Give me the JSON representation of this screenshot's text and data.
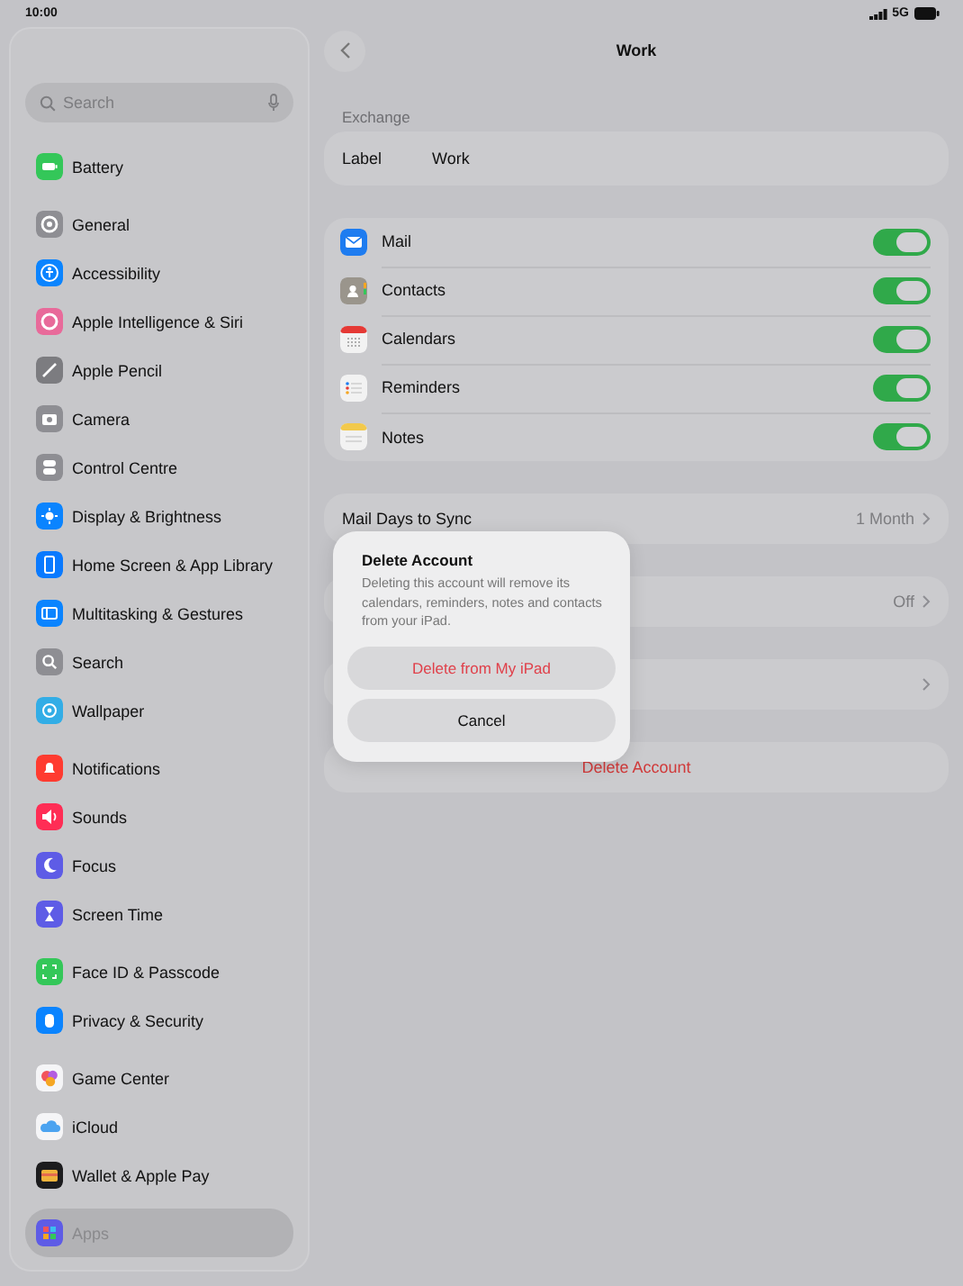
{
  "status_bar": {
    "time": "10:00",
    "network": "5G"
  },
  "sidebar": {
    "search": {
      "placeholder": "Search"
    },
    "groups": [
      [
        {
          "label": "Battery",
          "color": "#34c759",
          "selected": false
        }
      ],
      [
        {
          "label": "General",
          "color": "#8e8e93",
          "selected": false
        },
        {
          "label": "Accessibility",
          "color": "#0a84ff",
          "selected": false
        },
        {
          "label": "Apple Intelligence & Siri",
          "color": "#e86a9a",
          "selected": false
        },
        {
          "label": "Apple Pencil",
          "color": "#7c7c80",
          "selected": false
        },
        {
          "label": "Camera",
          "color": "#8e8e93",
          "selected": false
        },
        {
          "label": "Control Centre",
          "color": "#8e8e93",
          "selected": false
        },
        {
          "label": "Display & Brightness",
          "color": "#0a84ff",
          "selected": false
        },
        {
          "label": "Home Screen & App Library",
          "color": "#0a7aff",
          "selected": false
        },
        {
          "label": "Multitasking & Gestures",
          "color": "#0a84ff",
          "selected": false
        },
        {
          "label": "Search",
          "color": "#8e8e93",
          "selected": false
        },
        {
          "label": "Wallpaper",
          "color": "#32ade6",
          "selected": false
        }
      ],
      [
        {
          "label": "Notifications",
          "color": "#ff3b30",
          "selected": false
        },
        {
          "label": "Sounds",
          "color": "#ff2d55",
          "selected": false
        },
        {
          "label": "Focus",
          "color": "#5e5ce6",
          "selected": false
        },
        {
          "label": "Screen Time",
          "color": "#5e5ce6",
          "selected": false
        }
      ],
      [
        {
          "label": "Face ID & Passcode",
          "color": "#34c759",
          "selected": false
        },
        {
          "label": "Privacy & Security",
          "color": "#0a84ff",
          "selected": false
        }
      ],
      [
        {
          "label": "Game Center",
          "color": "#f5f5f7",
          "selected": false
        },
        {
          "label": "iCloud",
          "color": "#f5f5f7",
          "selected": false
        },
        {
          "label": "Wallet & Apple Pay",
          "color": "#1c1c1e",
          "selected": false
        }
      ],
      [
        {
          "label": "Apps",
          "color": "#5e5ce6",
          "selected": true
        }
      ]
    ]
  },
  "detail": {
    "title": "Work",
    "section_header": "Exchange",
    "label_row": {
      "label": "Label",
      "value": "Work"
    },
    "services": [
      {
        "label": "Mail",
        "color": "#1e7cf0",
        "on": true
      },
      {
        "label": "Contacts",
        "color": "#9a958c",
        "on": true
      },
      {
        "label": "Calendars",
        "color": "#f2f2f2",
        "on": true
      },
      {
        "label": "Reminders",
        "color": "#f2f2f2",
        "on": true
      },
      {
        "label": "Notes",
        "color": "#f2f2f2",
        "on": true
      }
    ],
    "settings_rows": [
      {
        "label": "Mail Days to Sync",
        "value": "1 Month"
      },
      {
        "value": "Off"
      },
      {}
    ],
    "delete_button": "Delete Account"
  },
  "alert": {
    "title": "Delete Account",
    "message": "Deleting this account will remove its calendars, reminders, notes and contacts from your iPad.",
    "buttons": [
      {
        "label": "Delete from My iPad",
        "kind": "destructive"
      },
      {
        "label": "Cancel",
        "kind": "cancel"
      }
    ]
  }
}
